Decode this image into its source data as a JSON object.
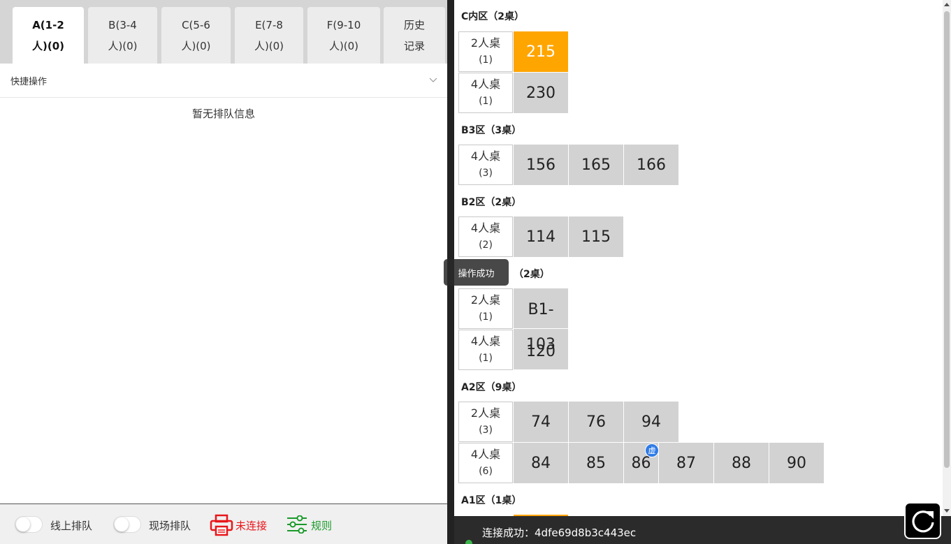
{
  "tabs": [
    {
      "line1": "A(1-2",
      "line2": "人)(0)",
      "active": true
    },
    {
      "line1": "B(3-4",
      "line2": "人)(0)"
    },
    {
      "line1": "C(5-6",
      "line2": "人)(0)"
    },
    {
      "line1": "E(7-8",
      "line2": "人)(0)"
    },
    {
      "line1": "F(9-10",
      "line2": "人)(0)"
    },
    {
      "line1": "历史",
      "line2": "记录"
    }
  ],
  "quick_ops": {
    "label": "快捷操作"
  },
  "queue": {
    "empty_message": "暂无排队信息"
  },
  "bottom": {
    "online_queue_label": "线上排队",
    "onsite_queue_label": "现场排队",
    "printer_label": "未连接",
    "rules_label": "规则",
    "printer_color": "#e8161b",
    "rules_color": "#1a9a2a"
  },
  "zones": {
    "c_inner": {
      "title": "C内区（2桌）",
      "rows": [
        {
          "label": "2人桌",
          "count": "(1)",
          "tables": [
            "215"
          ]
        },
        {
          "label": "4人桌",
          "count": "(1)",
          "tables": [
            "230"
          ]
        }
      ]
    },
    "b3": {
      "title": "B3区（3桌）",
      "rows": [
        {
          "label": "4人桌",
          "count": "(3)",
          "tables": [
            "156",
            "165",
            "166"
          ]
        }
      ]
    },
    "b2": {
      "title": "B2区（2桌）",
      "rows": [
        {
          "label": "4人桌",
          "count": "(2)",
          "tables": [
            "114",
            "115"
          ]
        }
      ]
    },
    "b1": {
      "title_partial": "（2桌）",
      "rows": [
        {
          "label": "2人桌",
          "count": "(1)",
          "tables": [
            "B1-",
            "103"
          ]
        },
        {
          "label": "4人桌",
          "count": "(1)",
          "tables": [
            "120"
          ]
        }
      ]
    },
    "a2": {
      "title": "A2区（9桌）",
      "rows": [
        {
          "label": "2人桌",
          "count": "(3)",
          "tables": [
            "74",
            "76",
            "94"
          ]
        },
        {
          "label": "4人桌",
          "count": "(6)",
          "tables": [
            "84",
            "85",
            "86",
            "87",
            "88",
            "90"
          ]
        }
      ],
      "virtual_badge": "虚"
    },
    "a1": {
      "title": "A1区（1桌）"
    }
  },
  "colors": {
    "occupied": "#ffa500",
    "free": "#d2d2d2",
    "badge": "#2f7be6"
  },
  "toast": {
    "message": "操作成功"
  },
  "status": {
    "text": "连接成功：4dfe69d8b3c443ec"
  },
  "icons": {
    "chevron": "chevron-down-icon",
    "printer": "printer-icon",
    "rules": "sliders-icon",
    "refresh": "refresh-icon"
  }
}
